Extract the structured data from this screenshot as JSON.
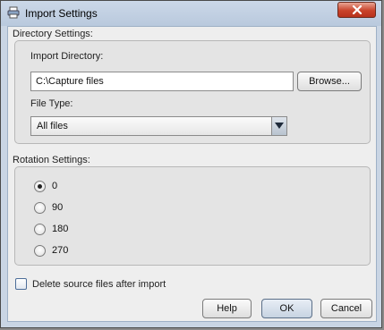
{
  "window": {
    "title": "Import Settings",
    "icon": "printer-icon"
  },
  "directory_settings": {
    "label": "Directory Settings:",
    "import_directory_label": "Import Directory:",
    "import_directory_value": "C:\\Capture files",
    "browse_label": "Browse...",
    "file_type_label": "File Type:",
    "file_type_value": "All files"
  },
  "rotation_settings": {
    "label": "Rotation Settings:",
    "options": [
      "0",
      "90",
      "180",
      "270"
    ],
    "selected": "0"
  },
  "delete_source": {
    "label": "Delete source files after import",
    "checked": false
  },
  "buttons": {
    "help": "Help",
    "ok": "OK",
    "cancel": "Cancel"
  }
}
